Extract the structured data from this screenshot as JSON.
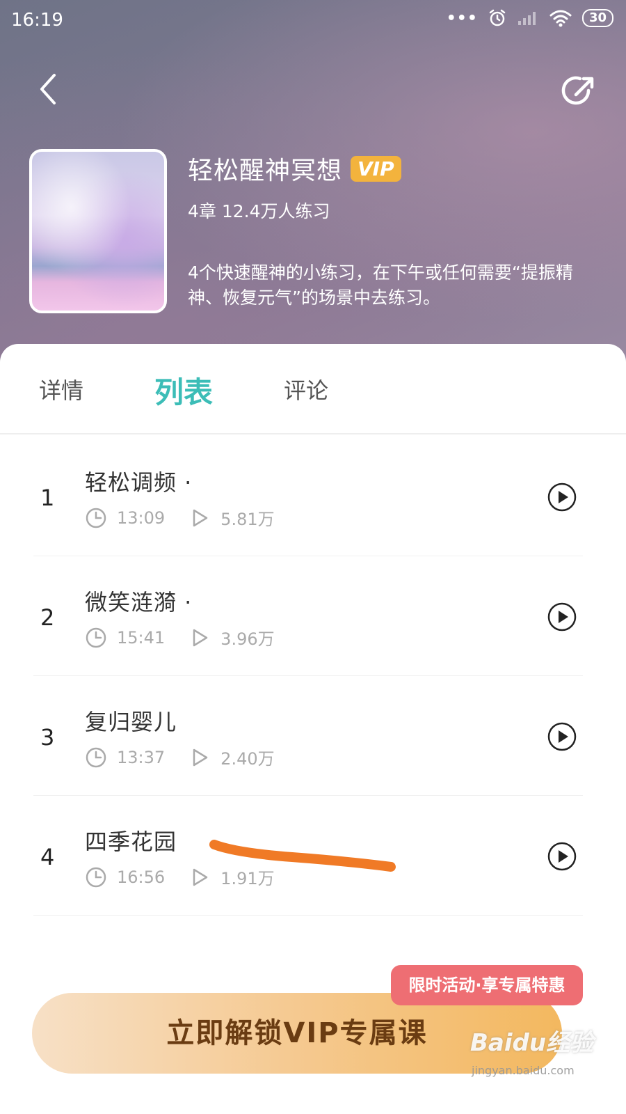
{
  "status_bar": {
    "time": "16:19",
    "dots": "•••",
    "battery": "30"
  },
  "course": {
    "title": "轻松醒神冥想",
    "badge": "VIP",
    "meta": "4章 12.4万人练习",
    "description": "4个快速醒神的小练习，在下午或任何需要“提振精神、恢复元气”的场景中去练习。"
  },
  "tabs": [
    {
      "label": "详情"
    },
    {
      "label": "列表"
    },
    {
      "label": "评论"
    }
  ],
  "tracks": [
    {
      "number": "1",
      "title": "轻松调频 ·",
      "duration": "13:09",
      "plays": "5.81万"
    },
    {
      "number": "2",
      "title": "微笑涟漪 ·",
      "duration": "15:41",
      "plays": "3.96万"
    },
    {
      "number": "3",
      "title": "复归婴儿",
      "duration": "13:37",
      "plays": "2.40万"
    },
    {
      "number": "4",
      "title": "四季花园",
      "duration": "16:56",
      "plays": "1.91万"
    }
  ],
  "promo": {
    "tag": "限时活动·享专属特惠",
    "button": "立即解锁VIP专属课"
  },
  "watermark": {
    "logo": "Baidu经验",
    "url": "jingyan.baidu.com"
  },
  "colors": {
    "accent": "#3cbdb7",
    "vip_badge": "#f3b33d",
    "promo_tag": "#ee6e73",
    "unlock_button": "#f3b85f"
  }
}
